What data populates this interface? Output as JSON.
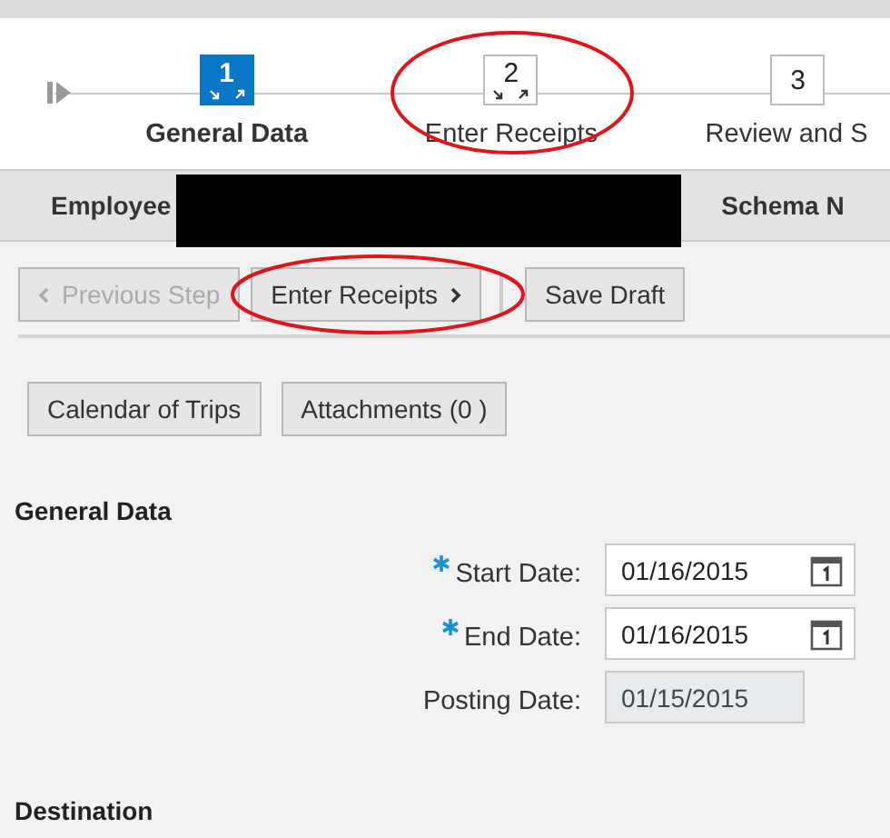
{
  "roadmap": {
    "steps": [
      {
        "number": "1",
        "label": "General Data",
        "selected": true,
        "expandable": true,
        "highlighted": false
      },
      {
        "number": "2",
        "label": "Enter Receipts",
        "selected": false,
        "expandable": true,
        "highlighted": true
      },
      {
        "number": "3",
        "label": "Review and S",
        "selected": false,
        "expandable": false,
        "highlighted": false
      }
    ]
  },
  "header": {
    "employee_label": "Employee",
    "schema_label": "Schema N"
  },
  "toolbar": [
    {
      "label": "Previous Step",
      "kind": "back",
      "disabled": true,
      "highlighted": false
    },
    {
      "label": "Enter Receipts",
      "kind": "next",
      "disabled": false,
      "highlighted": true
    },
    {
      "label": "Save Draft",
      "kind": "plain",
      "disabled": false,
      "highlighted": false
    }
  ],
  "actions": [
    "Calendar of Trips",
    "Attachments (0 )"
  ],
  "general_data": {
    "title": "General Data",
    "fields": [
      {
        "label": "Start Date:",
        "value": "01/16/2015",
        "required": true,
        "disabled": false
      },
      {
        "label": "End Date:",
        "value": "01/16/2015",
        "required": true,
        "disabled": false
      },
      {
        "label": "Posting Date:",
        "value": "01/15/2015",
        "required": false,
        "disabled": true
      }
    ]
  },
  "destination": {
    "title": "Destination"
  }
}
